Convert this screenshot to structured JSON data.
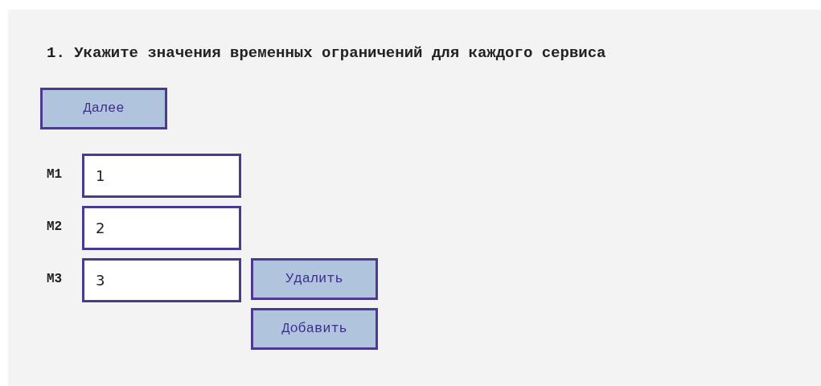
{
  "heading": "1. Укажите значения временных ограничений для каждого сервиса",
  "next_button": "Далее",
  "fields": [
    {
      "label": "M1",
      "value": "1"
    },
    {
      "label": "M2",
      "value": "2"
    },
    {
      "label": "M3",
      "value": "3"
    }
  ],
  "remove_button": "Удалить",
  "add_button": "Добавить"
}
